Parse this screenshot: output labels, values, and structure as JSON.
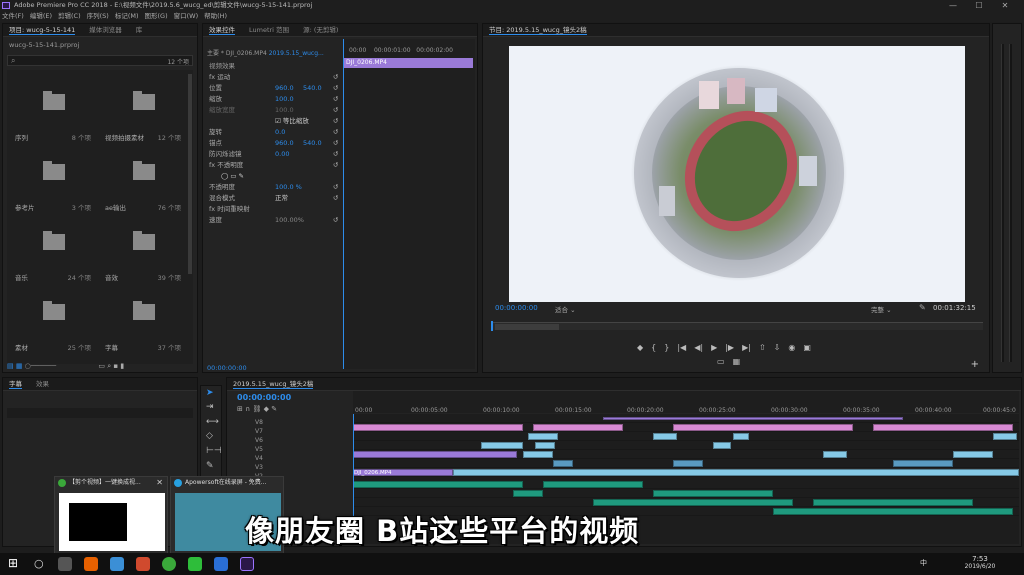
{
  "window": {
    "title": "Adobe Premiere Pro CC 2018 - E:\\视频文件\\2019.5.6_wucg_ed\\剪辑文件\\wucg-5-15-141.prproj",
    "min": "—",
    "max": "☐",
    "close": "✕"
  },
  "menu": [
    "文件(F)",
    "编辑(E)",
    "剪辑(C)",
    "序列(S)",
    "标记(M)",
    "图形(G)",
    "窗口(W)",
    "帮助(H)"
  ],
  "project": {
    "tabs": [
      "项目: wucg-5-15-141",
      "媒体浏览器",
      "库",
      "信息"
    ],
    "file": "wucg-5-15-141.prproj",
    "item_count": "12 个项",
    "bins": [
      {
        "name": "序列",
        "count": "8 个项"
      },
      {
        "name": "视频拍摄素材",
        "count": "12 个项"
      },
      {
        "name": "参考片",
        "count": "3 个项"
      },
      {
        "name": "ae输出",
        "count": "76 个项"
      },
      {
        "name": "音乐",
        "count": "24 个项"
      },
      {
        "name": "音效",
        "count": "39 个项"
      },
      {
        "name": "素材",
        "count": "25 个项"
      },
      {
        "name": "字幕",
        "count": "37 个项"
      }
    ]
  },
  "effects": {
    "tabs": [
      "效果控件",
      "Lumetri 范围",
      "源: (无剪辑)",
      "音频剪辑混合器: 2019.5.15_wucg"
    ],
    "master": "主要 * DJI_0206.MP4",
    "seq": "2019.5.15_wucg...",
    "header": "视频效果",
    "times": [
      "00:00",
      "00:00:01:00",
      "00:00:02:00"
    ],
    "clip": "DJI_0206.MP4",
    "rows": [
      {
        "label": "fx  运动",
        "v": "",
        "v2": ""
      },
      {
        "label": "  位置",
        "v": "960.0",
        "v2": "540.0"
      },
      {
        "label": "  缩放",
        "v": "100.0",
        "v2": ""
      },
      {
        "label": "  缩放宽度",
        "v": "100.0",
        "v2": ""
      },
      {
        "label": "",
        "v": "",
        "v2": ""
      },
      {
        "label": "  旋转",
        "v": "0.0",
        "v2": ""
      },
      {
        "label": "  锚点",
        "v": "960.0",
        "v2": "540.0"
      },
      {
        "label": "  防闪烁滤镜",
        "v": "0.00",
        "v2": ""
      },
      {
        "label": "fx  不透明度",
        "v": "",
        "v2": ""
      },
      {
        "label": "",
        "v": "",
        "v2": ""
      },
      {
        "label": "  不透明度",
        "v": "100.0 %",
        "v2": ""
      },
      {
        "label": "  混合模式",
        "v": "正常",
        "v2": ""
      },
      {
        "label": "fx  时间重映射",
        "v": "",
        "v2": ""
      },
      {
        "label": "  速度",
        "v": "100.00%",
        "v2": ""
      }
    ],
    "uniform": "等比缩放",
    "timecode": "00:00:00:00"
  },
  "program": {
    "title": "节目: 2019.5.15_wucg_镜头2稿",
    "timecode": "00:00:00:00",
    "fit": "适合",
    "quality": "完整",
    "duration": "00:01:32:15"
  },
  "captions": {
    "tabs": [
      "字幕",
      "效果"
    ]
  },
  "timeline": {
    "tab": "2019.5.15_wucg_镜头2稿",
    "timecode": "00:00:00:00",
    "ticks": [
      "00:00",
      "00:00:05:00",
      "00:00:10:00",
      "00:00:15:00",
      "00:00:20:00",
      "00:00:25:00",
      "00:00:30:00",
      "00:00:35:00",
      "00:00:40:00",
      "00:00:45:0"
    ],
    "tracks": [
      "V8",
      "V7",
      "V6",
      "V5",
      "V4",
      "V3",
      "V2",
      "V1",
      "A1",
      "A2",
      "A3",
      "A4",
      "A5"
    ],
    "v1_label": "DJI_0206.MP4"
  },
  "popups": [
    {
      "title": "【剪个视频】一键换成视..."
    },
    {
      "title": "Apowersoft在线录屏 - 免费..."
    }
  ],
  "caption": "像朋友圈 B站这些平台的视频",
  "taskbar": {
    "time": "7:53",
    "date": "2019/6/20",
    "lang": "中"
  },
  "colors": {
    "accent": "#2d8ceb",
    "clip_pink": "#d88ad4",
    "clip_blue": "#86c9e6",
    "clip_purple": "#9a7ad8",
    "audio": "#1f9a7e"
  }
}
